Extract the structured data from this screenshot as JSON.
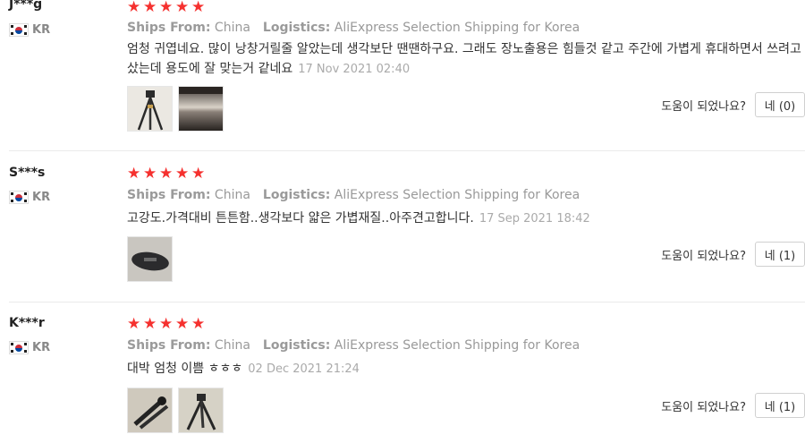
{
  "helpful_question": "도움이 되었나요?",
  "meta": {
    "ships_from_label": "Ships From:",
    "logistics_label": "Logistics:"
  },
  "reviews": [
    {
      "user": "J***g",
      "country": "KR",
      "rating": 5,
      "ships_from": "China",
      "logistics": "AliExpress Selection Shipping for Korea",
      "text": "엄청 귀엽네요. 많이 낭창거릴줄 알았는데 생각보단 땐땐하구요. 그래도 장노출용은 힘들것 같고 주간에 가볍게 휴대하면서 쓰려고 샀는데 용도에 잘 맞는거 같네요",
      "date": "17 Nov 2021 02:40",
      "photos": [
        "tripod-photo",
        "tripod-closeup-photo"
      ],
      "helpful_button": "네 (0)"
    },
    {
      "user": "S***s",
      "country": "KR",
      "rating": 5,
      "ships_from": "China",
      "logistics": "AliExpress Selection Shipping for Korea",
      "text": "고강도.가격대비 튼튼함..생각보다 얇은 가볍재질..아주견고합니다.",
      "date": "17 Sep 2021 18:42",
      "photos": [
        "tripod-bag-photo"
      ],
      "helpful_button": "네 (1)"
    },
    {
      "user": "K***r",
      "country": "KR",
      "rating": 5,
      "ships_from": "China",
      "logistics": "AliExpress Selection Shipping for Korea",
      "text": "대박 엄청 이쁨 ㅎㅎㅎ",
      "date": "02 Dec 2021 21:24",
      "photos": [
        "tripod-folded-photo",
        "tripod-legs-photo"
      ],
      "helpful_button": "네 (1)"
    }
  ]
}
